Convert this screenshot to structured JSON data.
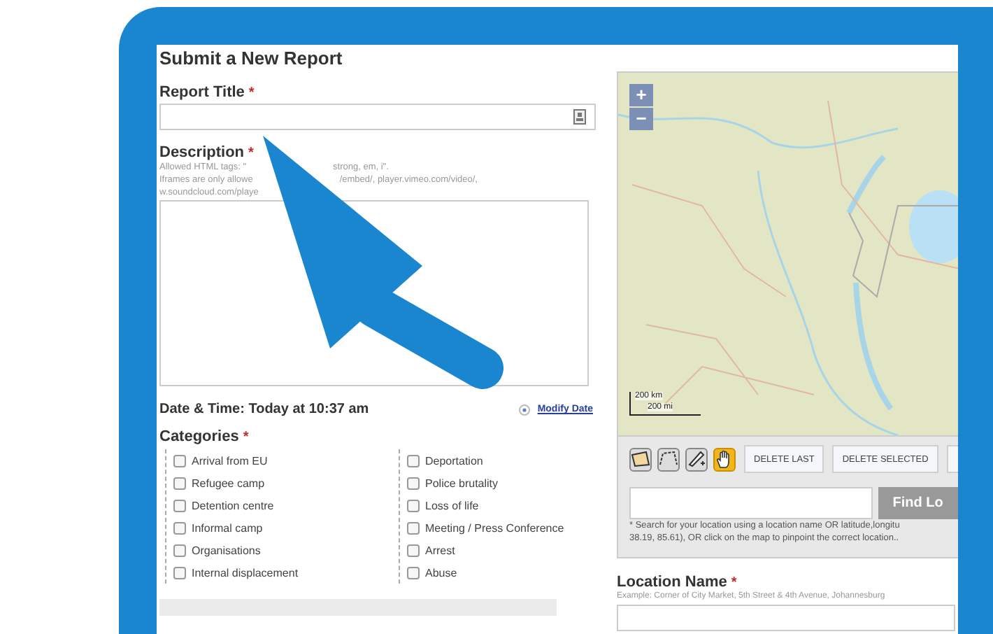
{
  "page": {
    "title": "Submit a New Report"
  },
  "report_title": {
    "label": "Report Title",
    "required_mark": "*"
  },
  "description": {
    "label": "Description",
    "required_mark": "*",
    "help_lines": [
      [
        "Allowed HTML tags: \"",
        "strong, em, i\"."
      ],
      [
        "Iframes are only allowe",
        "/embed/, player.vimeo.com/video/,"
      ],
      [
        "w.soundcloud.com/playe"
      ]
    ]
  },
  "date": {
    "label": "Date & Time: Today at 10:37 am",
    "link": "Modify Date"
  },
  "categories": {
    "label": "Categories",
    "required_mark": "*",
    "columns": [
      [
        {
          "label": "Arrival from EU",
          "checked": false
        },
        {
          "label": "Refugee camp",
          "checked": false
        },
        {
          "label": "Detention centre",
          "checked": false
        },
        {
          "label": "Informal camp",
          "checked": false
        },
        {
          "label": "Organisations",
          "checked": false
        },
        {
          "label": "Internal displacement",
          "checked": false
        }
      ],
      [
        {
          "label": "Deportation",
          "checked": false
        },
        {
          "label": "Police brutality",
          "checked": false
        },
        {
          "label": "Loss of life",
          "checked": false
        },
        {
          "label": "Meeting / Press Conference",
          "checked": false
        },
        {
          "label": "Arrest",
          "checked": false
        },
        {
          "label": "Abuse",
          "checked": false
        }
      ]
    ]
  },
  "map": {
    "zoom_in": "+",
    "zoom_out": "−",
    "scale": [
      "200 km",
      "200 mi"
    ],
    "tools": [
      {
        "kind": "polygon",
        "selected": false
      },
      {
        "kind": "line",
        "selected": false
      },
      {
        "kind": "pencil",
        "selected": false
      },
      {
        "kind": "pan",
        "selected": true
      }
    ],
    "buttons": [
      "DELETE LAST",
      "DELETE SELECTED"
    ]
  },
  "location_search": {
    "button": "Find Lo",
    "help_lines": [
      "* Search for your location using a location name OR latitude,longitu",
      "38.19, 85.61), OR click on the map to pinpoint the correct location.."
    ]
  },
  "location_name": {
    "label": "Location Name",
    "required_mark": "*",
    "example": "Example: Corner of City Market, 5th Street & 4th Avenue, Johannesburg"
  }
}
